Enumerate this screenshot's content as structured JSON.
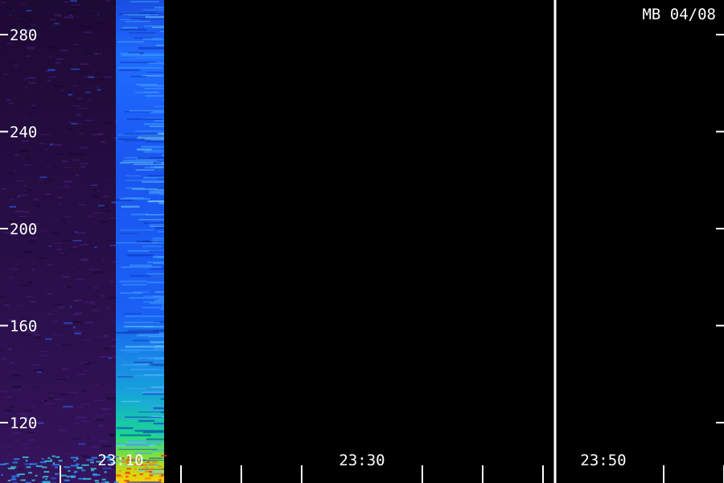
{
  "station_label": "MB 04/08",
  "chart_data": {
    "type": "heatmap",
    "title": "",
    "xlabel": "",
    "ylabel": "",
    "x_tick_labels": [
      "23:10",
      "23:30",
      "23:50"
    ],
    "y_ticks": [
      120,
      160,
      200,
      240,
      280
    ],
    "y_tick_labels": [
      "120",
      "160",
      "200",
      "240",
      "280"
    ],
    "ylim": [
      100,
      293
    ],
    "xlim_minutes": [
      "23:00",
      "23:59"
    ],
    "data_segments": [
      {
        "start": "23:00",
        "end": "23:09.6",
        "intensity": "low",
        "palette": "purple"
      },
      {
        "start": "23:09.6",
        "end": "23:13.6",
        "intensity": "high",
        "palette": "blue-green-yellow"
      }
    ],
    "marker_line": "23:46",
    "colors": {
      "background": "#000000",
      "axis": "#ffffff",
      "low": "#2a0f4a",
      "mid": "#1a5cff",
      "high": "#ffe000"
    }
  }
}
